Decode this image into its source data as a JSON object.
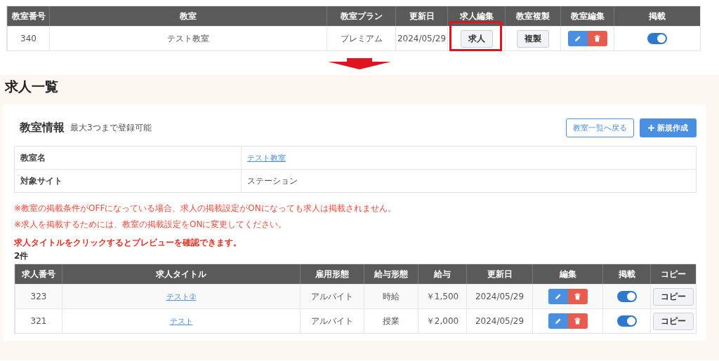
{
  "classroom_table": {
    "columns": [
      "教室番号",
      "教室",
      "教室プラン",
      "更新日",
      "求人編集",
      "教室複製",
      "教室編集",
      "掲載"
    ],
    "rows": [
      {
        "number": "340",
        "name": "テスト教室",
        "plan": "プレミアム",
        "updated": "2024/05/29",
        "job_button": "求人",
        "highlighted": true,
        "copy_button": "複製",
        "published": true
      }
    ]
  },
  "page": {
    "title": "求人一覧"
  },
  "info": {
    "heading": "教室情報",
    "note": "最大3つまで登録可能",
    "back_button": "教室一覧へ戻る",
    "new_button": "新規作成",
    "rows": [
      {
        "label": "教室名",
        "value": "テスト教室",
        "kind": "link"
      },
      {
        "label": "対象サイト",
        "value": "ステーション",
        "kind": "text"
      }
    ]
  },
  "warnings": [
    "※教室の掲載条件がOFFになっている場合、求人の掲載設定がONになっても求人は掲載されません。",
    "※求人を掲載するためには、教室の掲載設定をONに変更してください。"
  ],
  "hint": "求人タイトルをクリックするとプレビューを確認できます。",
  "count": "2件",
  "jobs": {
    "columns": [
      "求人番号",
      "求人タイトル",
      "雇用形態",
      "給与形態",
      "給与",
      "更新日",
      "編集",
      "掲載",
      "コピー"
    ],
    "rows": [
      {
        "number": "323",
        "title": "テスト②",
        "employment": "アルバイト",
        "pay_type": "時給",
        "pay": "￥1,500",
        "updated": "2024/05/29",
        "published": true,
        "copy_button": "コピー"
      },
      {
        "number": "321",
        "title": "テスト",
        "employment": "アルバイト",
        "pay_type": "授業",
        "pay": "￥2,000",
        "updated": "2024/05/29",
        "published": true,
        "copy_button": "コピー"
      }
    ]
  }
}
